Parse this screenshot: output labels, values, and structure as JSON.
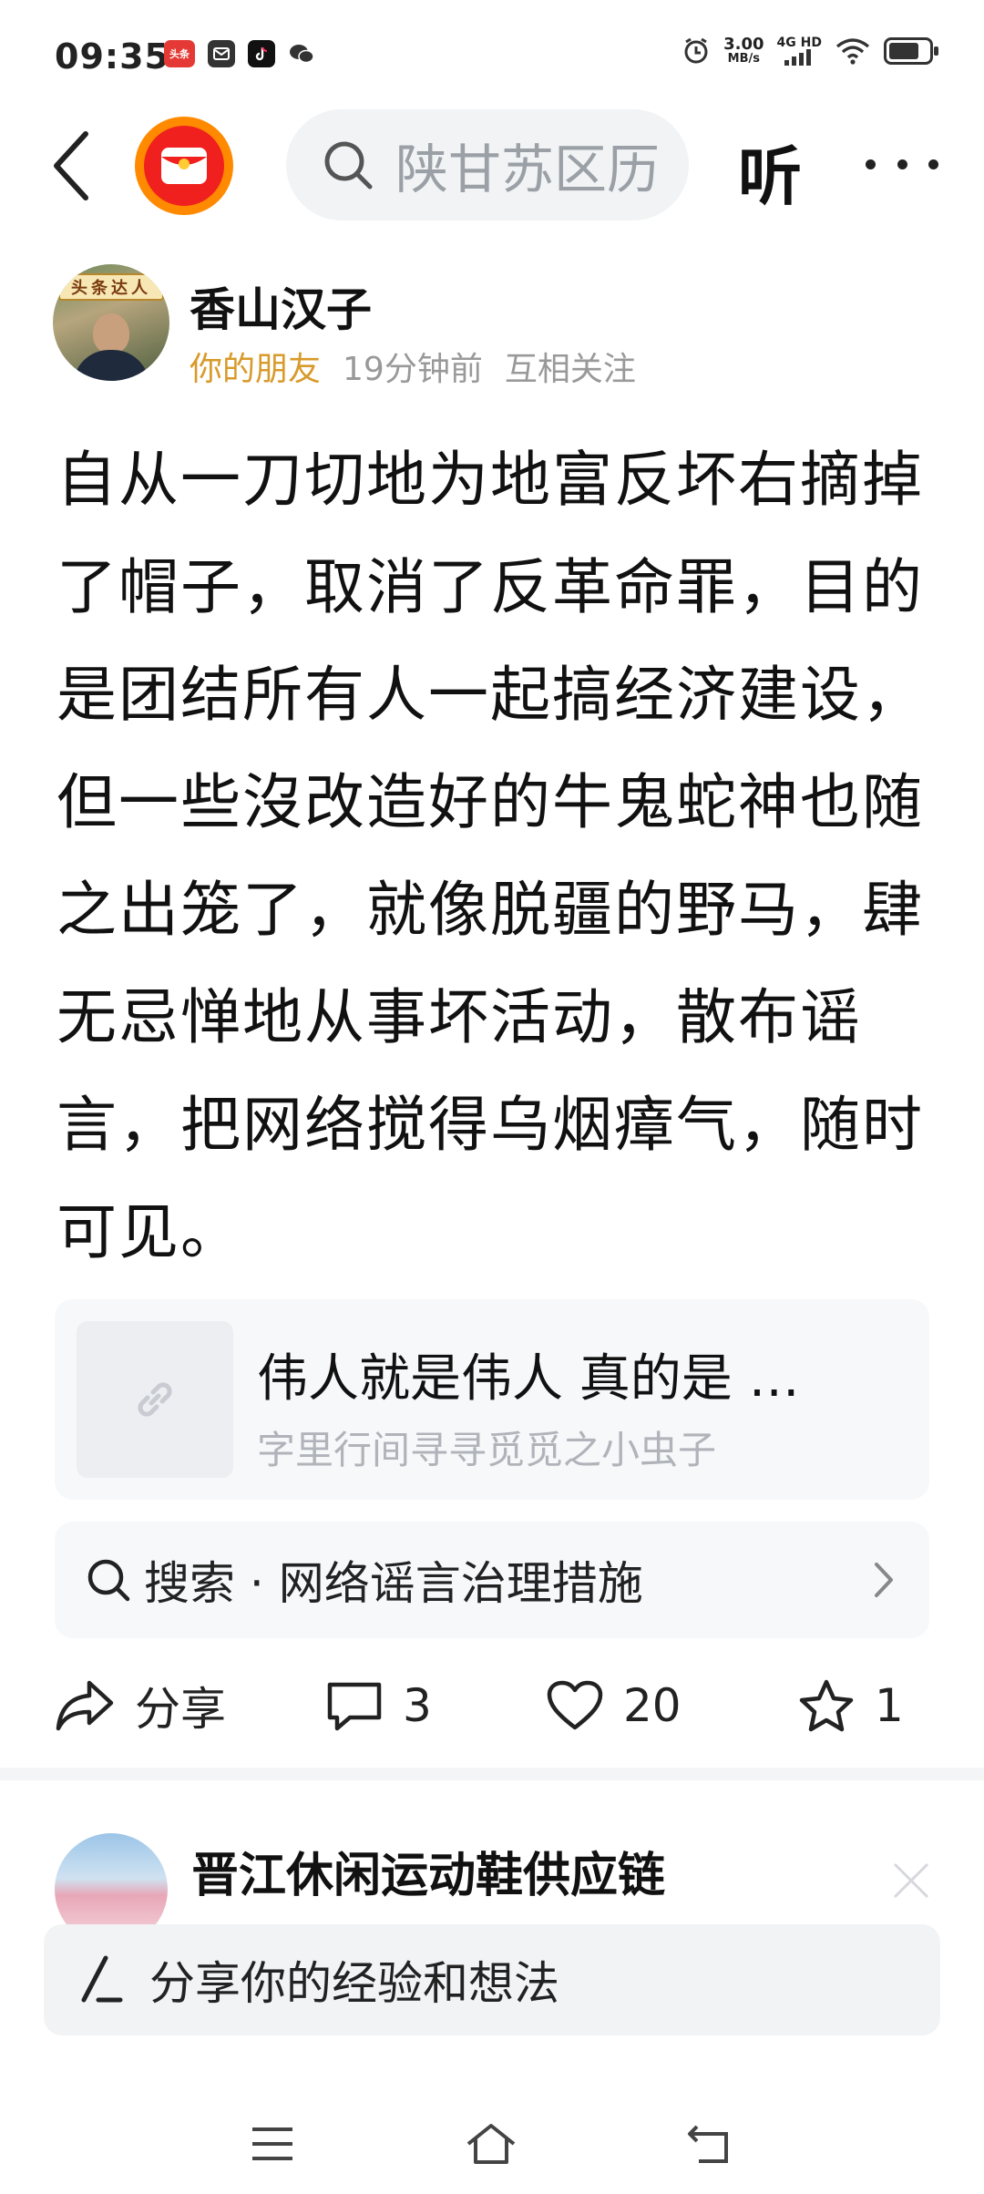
{
  "status_bar": {
    "time": "09:35",
    "app_badges": [
      "头条",
      "",
      "",
      ""
    ],
    "net_speed": "3.00",
    "net_unit": "MB/s",
    "net_type": "4G HD",
    "battery_level": 0.75
  },
  "header": {
    "search_placeholder": "陕甘苏区历",
    "listen_label": "听"
  },
  "post": {
    "author": {
      "name": "香山汉子",
      "avatar_banner": "头条达人",
      "relation": "你的朋友",
      "time": "19分钟前",
      "follow_status": "互相关注"
    },
    "content": "自从一刀切地为地富反坏右摘掉了帽子，取消了反革命罪，目的是团结所有人一起搞经济建设，但一些沒改造好的牛鬼蛇神也随之出笼了，就像脱疆的野马，肆无忌惮地从事坏活动，散布谣言，把网络搅得乌烟瘴气，随时可见。",
    "link_card": {
      "title": "伟人就是伟人 真的是 …",
      "source": "字里行间寻寻觅觅之小虫子"
    },
    "search_suggestion": {
      "prefix": "搜索",
      "separator": "·",
      "query": "网络谣言治理措施"
    },
    "actions": {
      "share_label": "分享",
      "comment_count": "3",
      "like_count": "20",
      "favorite_count": "1"
    }
  },
  "next_item": {
    "title": "晋江休闲运动鞋供应链"
  },
  "comment_bar": {
    "placeholder": "分享你的经验和想法"
  }
}
